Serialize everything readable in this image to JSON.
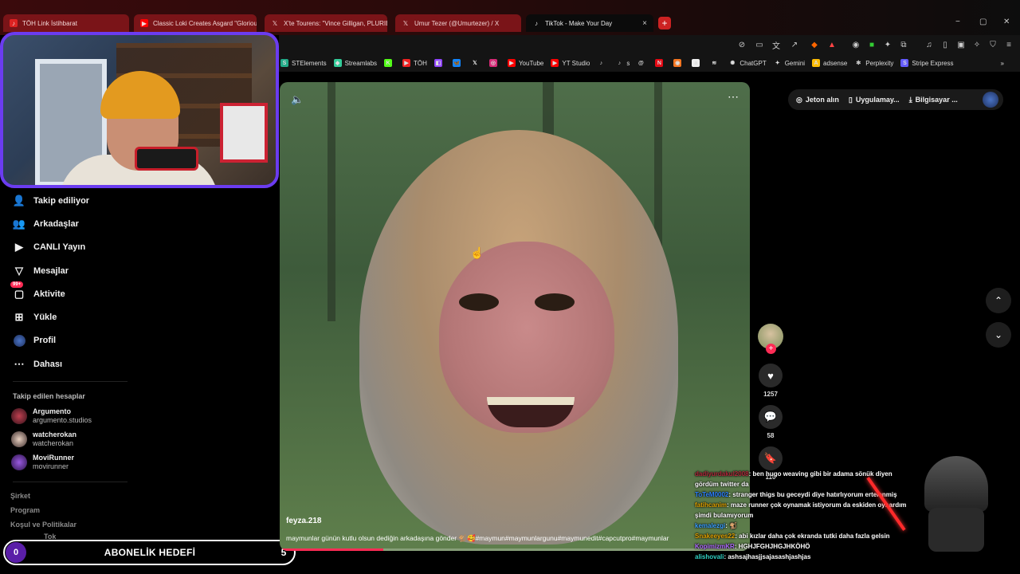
{
  "browser": {
    "tabs": [
      {
        "label": "TÖH Link İstihbarat",
        "icon": "tiktok-red"
      },
      {
        "label": "Classic Loki Creates Asgard \"Glorious",
        "icon": "youtube"
      },
      {
        "label": "X'te Tourens: \"Vince Gilligan, PLURIB",
        "icon": "x"
      },
      {
        "label": "Umur Tezer (@Umurtezer) / X",
        "icon": "x"
      },
      {
        "label": "TikTok - Make Your Day",
        "icon": "tiktok"
      }
    ],
    "active_tab_close": "×",
    "new_tab": "+",
    "window_controls": [
      "−",
      "▢",
      "✕"
    ],
    "bookmarks": [
      {
        "label": "STElements",
        "icon": "st"
      },
      {
        "label": "Streamlabs",
        "icon": "streamlabs"
      },
      {
        "label": "",
        "icon": "kick"
      },
      {
        "label": "TÖH",
        "icon": "youtube-red"
      },
      {
        "label": "",
        "icon": "twitch"
      },
      {
        "label": "",
        "icon": "bluesky"
      },
      {
        "label": "",
        "icon": "x"
      },
      {
        "label": "",
        "icon": "instagram"
      },
      {
        "label": "YouTube",
        "icon": "youtube"
      },
      {
        "label": "YT Studio",
        "icon": "youtube"
      },
      {
        "label": "",
        "icon": "tiktok"
      },
      {
        "label": "s",
        "icon": "tiktok"
      },
      {
        "label": "",
        "icon": "threads"
      },
      {
        "label": "",
        "icon": "netflix"
      },
      {
        "label": "",
        "icon": "crunchyroll"
      },
      {
        "label": "",
        "icon": "amazon"
      },
      {
        "label": "",
        "icon": "letterboxd"
      },
      {
        "label": "ChatGPT",
        "icon": "chatgpt"
      },
      {
        "label": "Gemini",
        "icon": "gemini"
      },
      {
        "label": "adsense",
        "icon": "adsense"
      },
      {
        "label": "Perplexity",
        "icon": "perplexity"
      },
      {
        "label": "Stripe Express",
        "icon": "stripe"
      }
    ],
    "bookmarks_more": "»"
  },
  "sidebar": {
    "nav": [
      {
        "label": "Takip ediliyor",
        "icon": "following-icon"
      },
      {
        "label": "Arkadaşlar",
        "icon": "friends-icon"
      },
      {
        "label": "CANLI Yayın",
        "icon": "live-icon"
      },
      {
        "label": "Mesajlar",
        "icon": "messages-icon"
      },
      {
        "label": "Aktivite",
        "icon": "activity-icon",
        "badge": "99+"
      },
      {
        "label": "Yükle",
        "icon": "upload-icon"
      },
      {
        "label": "Profil",
        "icon": "profile-icon"
      },
      {
        "label": "Dahası",
        "icon": "more-icon"
      }
    ],
    "following_title": "Takip edilen hesaplar",
    "accounts": [
      {
        "name": "Argumento",
        "handle": "argumento.studios"
      },
      {
        "name": "watcherokan",
        "handle": "watcherokan"
      },
      {
        "name": "MoviRunner",
        "handle": "movirunner"
      }
    ],
    "footer": [
      "Şirket",
      "Program",
      "Koşul ve Politikalar"
    ],
    "footer_partial": "Tok"
  },
  "sub_goal": {
    "current": "0",
    "label": "ABONELİK HEDEFİ",
    "target": "5"
  },
  "video": {
    "author": "feyza.218",
    "caption": "maymunlar günün kutlu olsun dediğin arkadaşına gönder 🐒🥰#maymun#maymunlargunu#maymunedit#capcutpro#maymunlar",
    "progress": 0.22
  },
  "actions": {
    "likes": "1257",
    "comments": "58",
    "saves": "110"
  },
  "tiktok_header": {
    "coins": "Jeton alın",
    "app": "Uygulamay...",
    "download": "Bilgisayar ..."
  },
  "chat": [
    {
      "user": "dadiyurdakul2008",
      "color": "#b0263a",
      "text": ": ben hugo weaving gibi bir adama sönük diyen gördüm twitter da"
    },
    {
      "user": "ToTeM0002",
      "color": "#2a7fff",
      "text": ": stranger thigs bu geceydi diye hatırlıyorum ertelenmiş"
    },
    {
      "user": "fatihcanim",
      "color": "#e0a000",
      "text": ": maze runner çok oynamak istiyorum da eskiden oynardım şimdi bulamıyorum"
    },
    {
      "user": "kemalezgi",
      "color": "#3aa0ff",
      "text": ": 🐒"
    },
    {
      "user": "Snakeeyes22",
      "color": "#e0a000",
      "text": ": abi kızlar daha çok ekranda tutki daha fazla gelsin"
    },
    {
      "user": "KopimizmKR",
      "color": "#b06bff",
      "text": ": HGHJFGHJHGJHKÖHÖ"
    },
    {
      "user": "alishovali",
      "color": "#2fd1c4",
      "text": ": ashsajhasjjsajasashjashjas"
    }
  ],
  "colors": {
    "accent": "#fe2c55",
    "webcam_border": "#6b3cf0",
    "tab_bg": "#7a1418"
  }
}
